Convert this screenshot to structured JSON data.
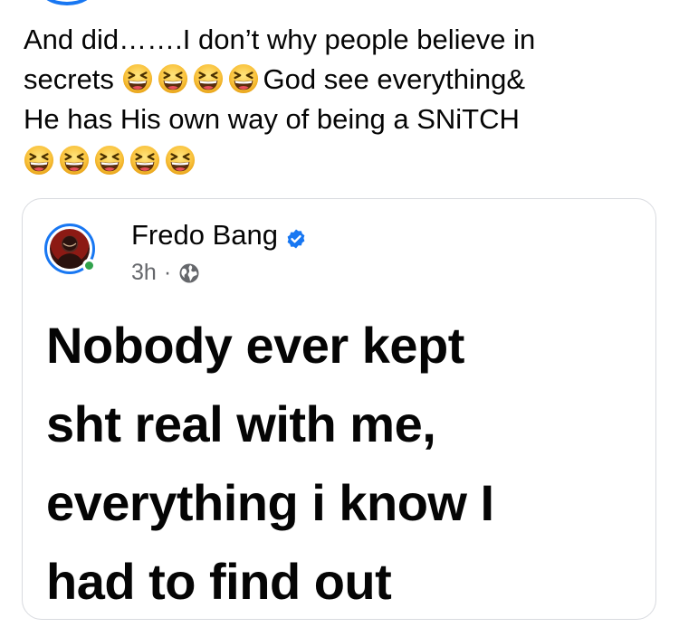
{
  "post": {
    "text_lines": [
      "And did…….I don’t why people believe in",
      "secrets",
      "God see everything&",
      "He has His own way of being a SNiTCH"
    ],
    "emoji_name": "grinning-squinting-face-emoji"
  },
  "shared_post": {
    "author": "Fredo Bang",
    "verified": true,
    "time": "3h",
    "separator": "·",
    "audience_icon": "globe-icon",
    "body_lines": [
      "Nobody ever kept",
      "sht real with me,",
      "everything i know I",
      "had to find out"
    ]
  },
  "colors": {
    "brand_blue": "#1877f2",
    "online_green": "#31a24c",
    "emoji_yellow": "#f9c23c",
    "secondary_text": "#65676b"
  }
}
